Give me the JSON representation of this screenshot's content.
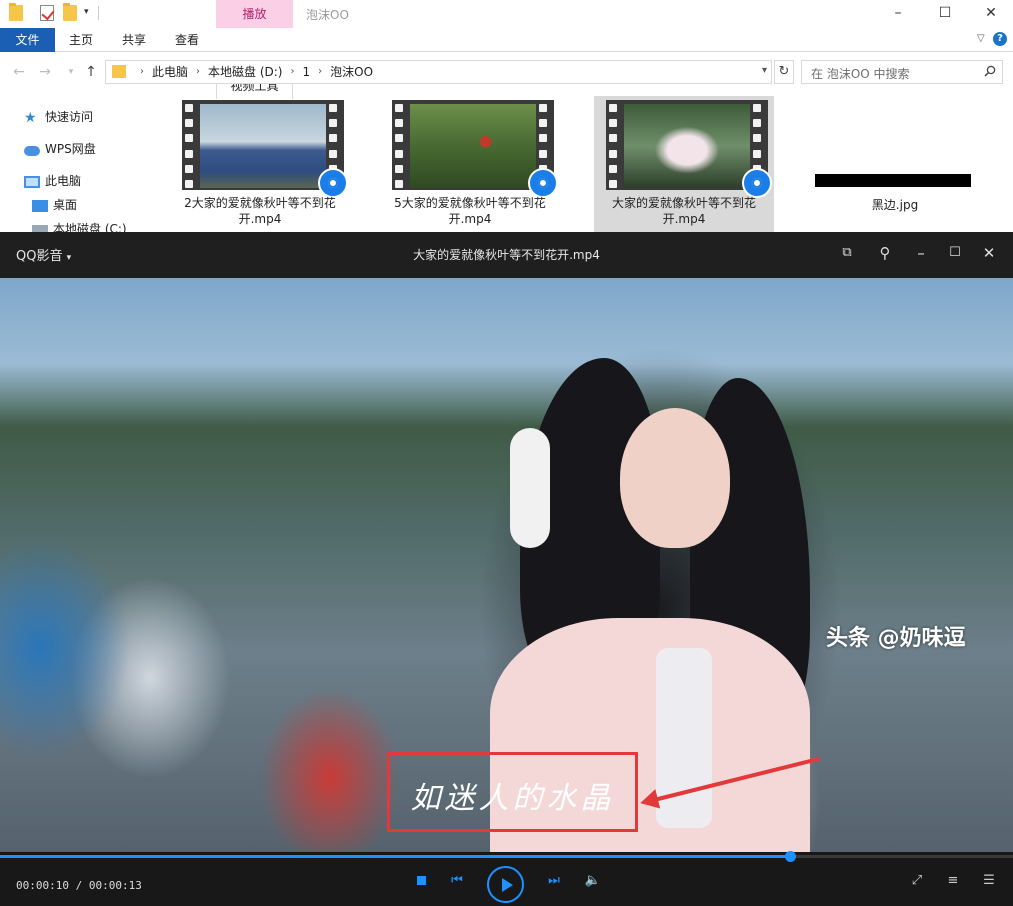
{
  "explorer": {
    "window_title": "泡沫OO",
    "context_tab_header": "播放",
    "ribbon_tabs": [
      "文件",
      "主页",
      "共享",
      "查看",
      "视频工具"
    ],
    "breadcrumbs": [
      "此电脑",
      "本地磁盘 (D:)",
      "1",
      "泡沫OO"
    ],
    "search_placeholder": "在 泡沫OO 中搜索",
    "nav": {
      "quick_access": "快速访问",
      "wps": "WPS网盘",
      "this_pc": "此电脑",
      "desktop": "桌面",
      "local_disk": "本地磁盘 (C:)"
    },
    "files": [
      {
        "name": "2大家的爱就像秋叶等不到花开.mp4",
        "selected": false
      },
      {
        "name": "5大家的爱就像秋叶等不到花开.mp4",
        "selected": false
      },
      {
        "name": "大家的爱就像秋叶等不到花开.mp4",
        "selected": true
      },
      {
        "name": "黑边.jpg",
        "selected": false
      }
    ]
  },
  "player": {
    "brand": "QQ影音",
    "title": "大家的爱就像秋叶等不到花开.mp4",
    "subtitle": "如迷人的水晶",
    "time_current": "00:00:10",
    "time_total": "00:00:13",
    "time_display": "00:00:10 / 00:00:13",
    "progress": 0.78,
    "accent": "#1e90ff",
    "annotation_color": "#e23a3a"
  },
  "watermark": "头条 @奶味逗"
}
